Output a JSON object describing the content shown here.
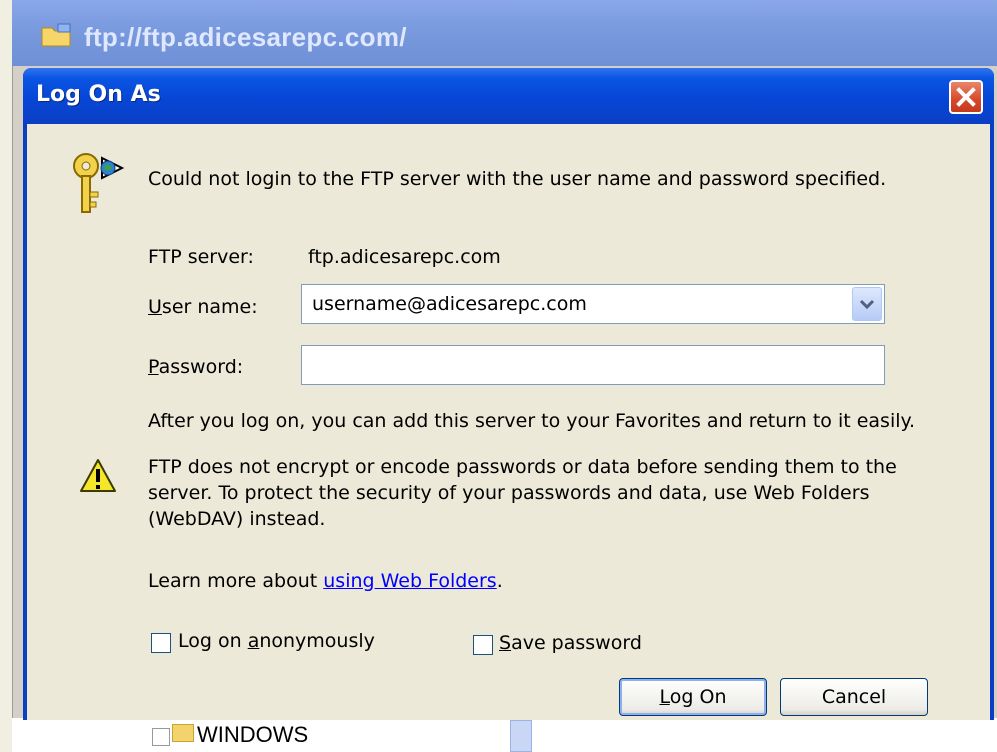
{
  "background_window": {
    "title": "ftp://ftp.adicesarepc.com/",
    "tree_item": "WINDOWS"
  },
  "dialog": {
    "title": "Log On As",
    "message": "Could not login to the FTP server with the user name and password specified.",
    "server_label": "FTP server:",
    "server_value": "ftp.adicesarepc.com",
    "username_label_accel": "U",
    "username_label_rest": "ser name:",
    "username_value": "username@adicesarepc.com",
    "password_label_accel": "P",
    "password_label_rest": "assword:",
    "password_value": "",
    "favorites_note": "After you log on, you can add this server to your Favorites and return to it easily.",
    "warning": "FTP does not encrypt or encode passwords or data before sending them to the server.  To protect the security of your passwords and data, use Web Folders (WebDAV) instead.",
    "learn_prefix": "Learn more about ",
    "learn_link": "using Web Folders",
    "learn_suffix": ".",
    "anon_label_pre": "Log on ",
    "anon_label_accel": "a",
    "anon_label_post": "nonymously",
    "anon_checked": false,
    "save_label_accel": "S",
    "save_label_rest": "ave password",
    "save_checked": false,
    "logon_button_accel": "L",
    "logon_button_rest": "og On",
    "cancel_button": "Cancel"
  },
  "icons": {
    "folder": "folder-icon",
    "close": "close-icon",
    "keys": "keys-globe-icon",
    "warning": "warning-icon",
    "dropdown": "chevron-down-icon"
  }
}
